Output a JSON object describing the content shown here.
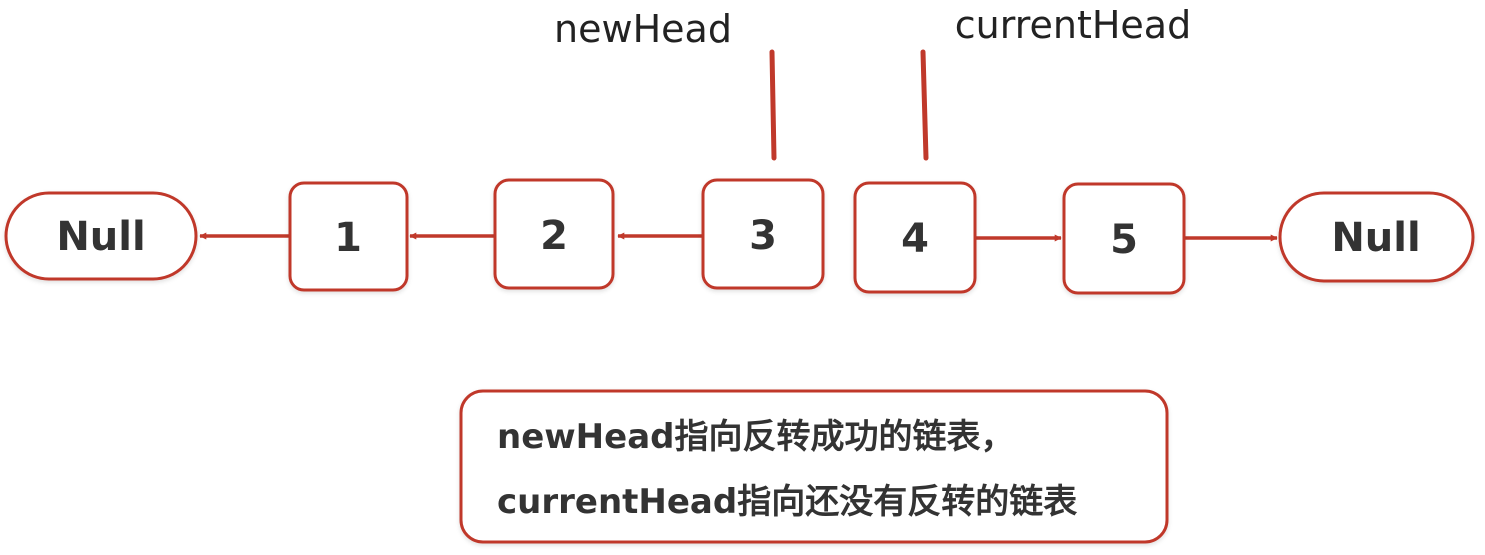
{
  "pointers": {
    "new_head": "newHead",
    "current_head": "currentHead"
  },
  "nodes": {
    "null_left": "Null",
    "n1": "1",
    "n2": "2",
    "n3": "3",
    "n4": "4",
    "n5": "5",
    "null_right": "Null"
  },
  "note": {
    "line1": "newHead指向反转成功的链表，",
    "line2": "currentHead指向还没有反转的链表"
  },
  "colors": {
    "accent": "#c0392b",
    "node_fill": "#ffffff",
    "text": "#333333"
  }
}
